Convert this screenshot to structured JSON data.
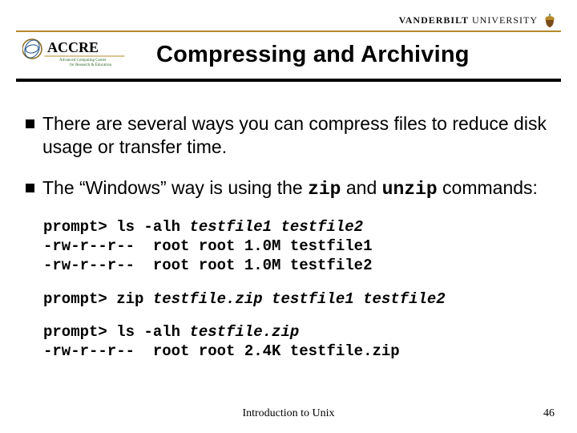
{
  "header": {
    "university_name_html": "VANDERBILT",
    "university_suffix": "UNIVERSITY",
    "logo_alt": "vanderbilt-acorn"
  },
  "accre": {
    "main": "ACCRE",
    "sub1": "Advanced Computing Center",
    "sub2": "for Research & Education"
  },
  "title": "Compressing and Archiving",
  "bullets": [
    {
      "text_before": "There are several ways you can compress files to reduce disk usage or transfer time.",
      "text_after": ""
    },
    {
      "text_before": "The “Windows” way is using the ",
      "code1": "zip",
      "mid": " and ",
      "code2": "unzip",
      "text_after": " commands:"
    }
  ],
  "code": {
    "block1": {
      "l1_p": "prompt> ",
      "l1_c": "ls -alh ",
      "l1_a": "testfile1 testfile2",
      "l2": "-rw-r--r--  root root 1.0M testfile1",
      "l3": "-rw-r--r--  root root 1.0M testfile2"
    },
    "block2": {
      "l1_p": "prompt> ",
      "l1_c": "zip ",
      "l1_a": "testfile.zip testfile1 testfile2"
    },
    "block3": {
      "l1_p": "prompt> ",
      "l1_c": "ls -alh ",
      "l1_a": "testfile.zip",
      "l2": "-rw-r--r--  root root 2.4K testfile.zip"
    }
  },
  "footer": {
    "title": "Introduction to Unix",
    "page": "46"
  }
}
